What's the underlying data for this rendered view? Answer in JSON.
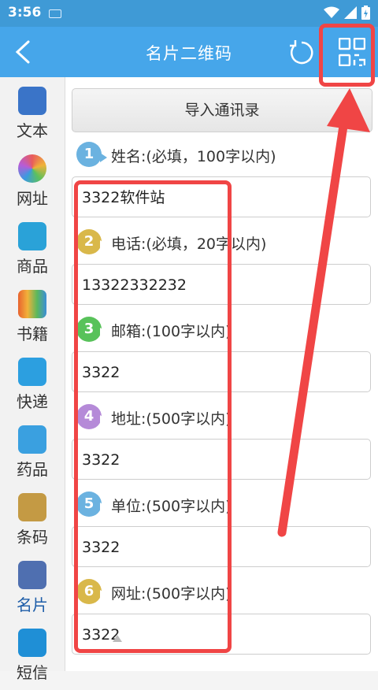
{
  "status": {
    "time": "3:56"
  },
  "header": {
    "title": "名片二维码"
  },
  "sidebar": {
    "items": [
      {
        "label": "文本",
        "color": "#3a74c8"
      },
      {
        "label": "网址",
        "color": "#e85c5c"
      },
      {
        "label": "商品",
        "color": "#2aa2d8"
      },
      {
        "label": "书籍",
        "color": "#e8632f"
      },
      {
        "label": "快递",
        "color": "#2c9fe0"
      },
      {
        "label": "药品",
        "color": "#3aa0e0"
      },
      {
        "label": "条码",
        "color": "#c49a44"
      },
      {
        "label": "名片",
        "color": "#4f6fb0"
      },
      {
        "label": "短信",
        "color": "#1f8fd6"
      }
    ]
  },
  "form": {
    "import_label": "导入通讯录",
    "fields": [
      {
        "num": "1",
        "label": "姓名:(必填，100字以内)",
        "value": "3322软件站",
        "badge_color": "#6bb2e0"
      },
      {
        "num": "2",
        "label": "电话:(必填，20字以内)",
        "value": "13322332232",
        "badge_color": "#d9b84a"
      },
      {
        "num": "3",
        "label": "邮箱:(100字以内)",
        "value": "3322",
        "badge_color": "#58c25a"
      },
      {
        "num": "4",
        "label": "地址:(500字以内)",
        "value": "3322",
        "badge_color": "#b58ad8"
      },
      {
        "num": "5",
        "label": "单位:(500字以内)",
        "value": "3322",
        "badge_color": "#6bb2e0"
      },
      {
        "num": "6",
        "label": "网址:(500字以内)",
        "value": "3322",
        "badge_color": "#d9b84a"
      }
    ]
  },
  "colors": {
    "header_bg": "#46a6ea",
    "status_bg": "#3f9ad6",
    "highlight": "#f04545"
  }
}
